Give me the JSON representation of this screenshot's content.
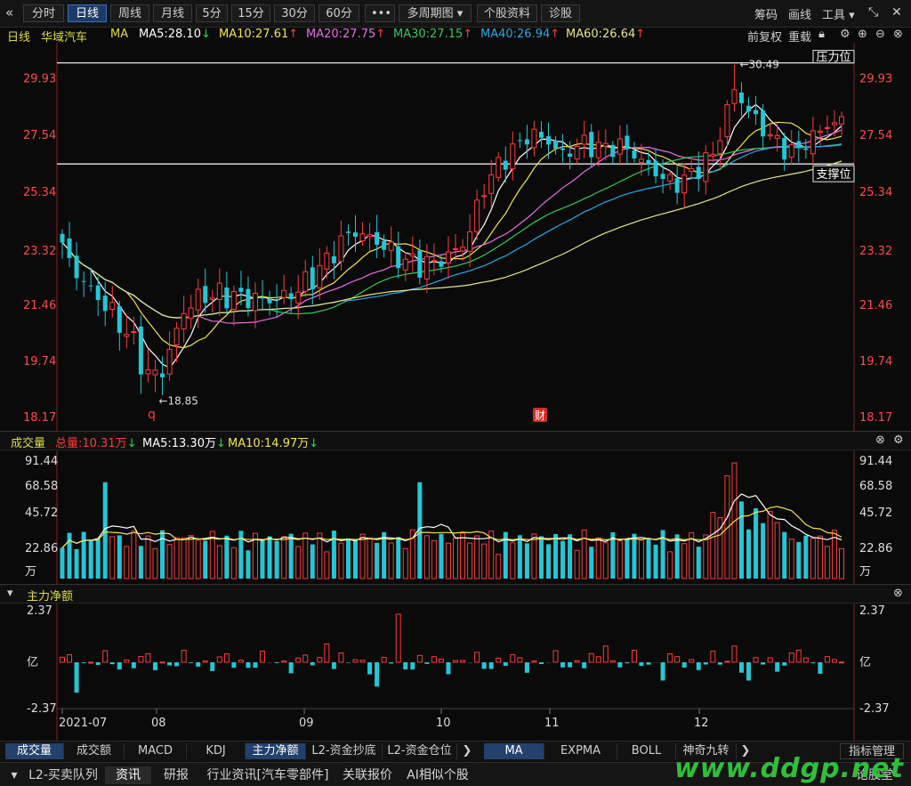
{
  "toolbar": {
    "back_glyph": "«",
    "periods": [
      "分时",
      "日线",
      "周线",
      "月线",
      "5分",
      "15分",
      "30分",
      "60分"
    ],
    "active_period": "日线",
    "more": "•••",
    "multi_period": "多周期图 ▾",
    "stock_info": "个股资料",
    "diagnose": "诊股",
    "right_items": [
      "筹码",
      "画线",
      "工具 ▾"
    ]
  },
  "legend": {
    "period": "日线",
    "stock_name": "华域汽车",
    "indicator": "MA",
    "ma5": "MA5:28.10",
    "ma10": "MA10:27.61",
    "ma20": "MA20:27.75",
    "ma30": "MA30:27.15",
    "ma40": "MA40:26.94",
    "ma60": "MA60:26.64",
    "ma5_dir": "↓",
    "ma10_dir": "↑",
    "ma20_dir": "↑",
    "ma30_dir": "↑",
    "ma40_dir": "↑",
    "ma60_dir": "↑",
    "right_a": "前复权",
    "right_b": "重载",
    "colors": {
      "ma5": "#ffffff",
      "ma10": "#f2e34c",
      "ma20": "#e86ee8",
      "ma30": "#37c85a",
      "ma40": "#2aa8e6",
      "ma60": "#e6e68a",
      "up": "#ff3b3b",
      "down": "#22c7d6"
    }
  },
  "volume_head": {
    "title": "成交量",
    "total": "总量:10.31万",
    "total_dir": "↓",
    "ma5": "MA5:13.30万",
    "ma5_dir": "↓",
    "ma10": "MA10:14.97万",
    "ma10_dir": "↓"
  },
  "flow_head": {
    "title": "主力净额"
  },
  "chart_data": [
    {
      "type": "candlestick",
      "title": "华域汽车 日线",
      "y_ticks": [
        "29.93",
        "27.54",
        "25.34",
        "23.32",
        "21.46",
        "19.74",
        "18.17"
      ],
      "ylim": [
        18.17,
        31.0
      ],
      "x_labels": [
        "2021-07",
        "08",
        "09",
        "10",
        "11",
        "12"
      ],
      "annotations": {
        "high": "←30.49",
        "low": "←18.85",
        "resistance": "压力位",
        "support": "支撑位",
        "marker_q": "q",
        "marker_cai": "财"
      },
      "resistance_level": 30.49,
      "support_level": 26.4,
      "grid": false
    },
    {
      "type": "bar",
      "title": "成交量",
      "y_ticks": [
        "91.44",
        "68.58",
        "45.72",
        "22.86",
        "万"
      ],
      "ylim": [
        0,
        91.44
      ],
      "unit": "万"
    },
    {
      "type": "bar",
      "title": "主力净额",
      "y_ticks": [
        "2.37",
        "亿",
        "-2.37"
      ],
      "ylim": [
        -2.37,
        2.37
      ],
      "unit": "亿"
    }
  ],
  "bottom_tabs": [
    "成交量",
    "成交额",
    "MACD",
    "KDJ",
    "主力净额",
    "L2-资金抄底",
    "L2-资金仓位"
  ],
  "bottom_tabs_active": [
    "成交量",
    "主力净额"
  ],
  "overlay_tabs": [
    "MA",
    "EXPMA",
    "BOLL",
    "神奇九转"
  ],
  "overlay_active": "MA",
  "indicator_manage": "指标管理",
  "status_tabs": [
    "L2-买卖队列",
    "资讯",
    "研报",
    "行业资讯[汽车零部件]",
    "关联报价",
    "AI相似个股"
  ],
  "status_active": "资讯",
  "status_right": "论股堂",
  "watermark": "www.ddgp.net"
}
